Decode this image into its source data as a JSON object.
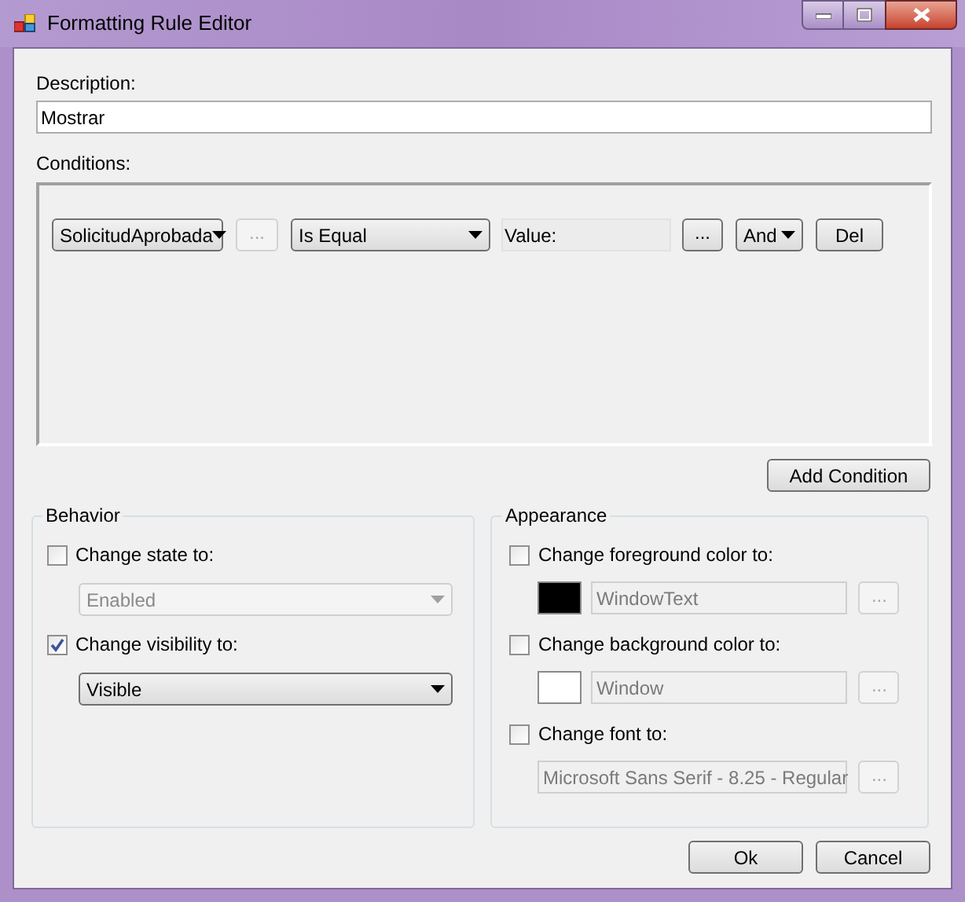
{
  "window": {
    "title": "Formatting Rule Editor"
  },
  "description": {
    "label": "Description:",
    "value": "Mostrar"
  },
  "conditions": {
    "label": "Conditions:",
    "rows": [
      {
        "field": {
          "value": "SolicitudAprobada"
        },
        "field_browse": {
          "label": "...",
          "disabled": true
        },
        "operator": {
          "value": "Is Equal"
        },
        "value_box": {
          "text": "Value:"
        },
        "value_browse": {
          "label": "...",
          "disabled": false
        },
        "join": {
          "value": "And"
        },
        "delete": "Del"
      }
    ],
    "add_button": "Add Condition"
  },
  "behavior": {
    "title": "Behavior",
    "options": [
      {
        "label": "Change state to:",
        "checked": false,
        "dropdown": {
          "value": "Enabled",
          "disabled": true
        }
      },
      {
        "label": "Change visibility to:",
        "checked": true,
        "dropdown": {
          "value": "Visible",
          "disabled": false
        }
      }
    ]
  },
  "appearance": {
    "title": "Appearance",
    "options": [
      {
        "kind": "color",
        "label": "Change foreground color to:",
        "checked": false,
        "color": "#000000",
        "value": "WindowText",
        "browse": {
          "label": "...",
          "disabled": true
        }
      },
      {
        "kind": "color",
        "label": "Change background color to:",
        "checked": false,
        "color": "#ffffff",
        "value": "Window",
        "browse": {
          "label": "...",
          "disabled": true
        }
      },
      {
        "kind": "font",
        "label": "Change font to:",
        "checked": false,
        "value": "Microsoft Sans Serif - 8.25 - Regular",
        "browse": {
          "label": "...",
          "disabled": true
        }
      }
    ]
  },
  "buttons": [
    "Ok",
    "Cancel"
  ]
}
